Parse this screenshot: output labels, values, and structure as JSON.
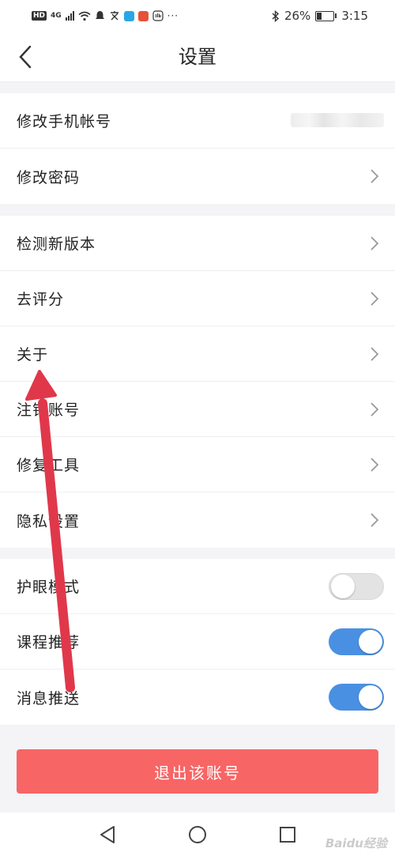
{
  "status_bar": {
    "network_badge": "HD",
    "network_type": "4G",
    "battery_percent": "26%",
    "battery_level": 0.26,
    "time": "3:15",
    "icons": [
      "signal-icon",
      "wifi-icon",
      "notification-icon",
      "translate-icon",
      "search-app-icon",
      "app-icon",
      "hand-icon",
      "bluetooth-icon",
      "battery-icon"
    ]
  },
  "header": {
    "title": "设置",
    "back_icon": "chevron-left-icon"
  },
  "groups": {
    "account": [
      {
        "label": "修改手机帐号",
        "value_redacted": true
      },
      {
        "label": "修改密码"
      }
    ],
    "general": [
      {
        "label": "检测新版本"
      },
      {
        "label": "去评分"
      },
      {
        "label": "关于"
      },
      {
        "label": "注销账号"
      },
      {
        "label": "修复工具"
      },
      {
        "label": "隐私设置"
      }
    ],
    "toggles": [
      {
        "label": "护眼模式",
        "on": false
      },
      {
        "label": "课程推荐",
        "on": true
      },
      {
        "label": "消息推送",
        "on": true
      }
    ]
  },
  "logout_label": "退出该账号",
  "nav_bar": {
    "icons": [
      "back-triangle-icon",
      "home-circle-icon",
      "recents-square-icon"
    ]
  },
  "watermark": "Baidu经验",
  "colors": {
    "accent_toggle": "#4a90e2",
    "logout_button": "#f86565",
    "background": "#f4f4f6",
    "annotation_arrow": "#e0384a"
  }
}
